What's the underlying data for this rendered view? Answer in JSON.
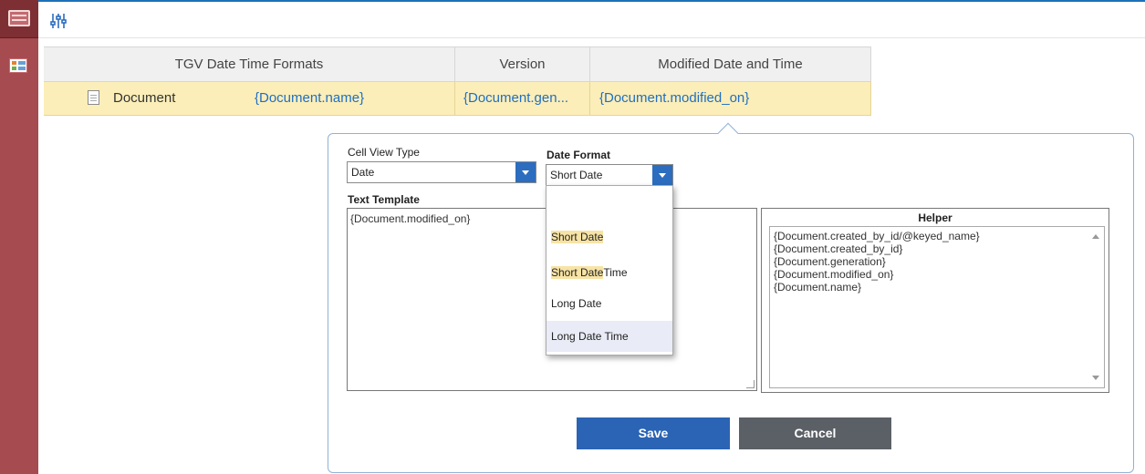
{
  "grid": {
    "columns": [
      "TGV Date Time Formats",
      "Version",
      "Modified Date and Time"
    ],
    "row": {
      "type": "Document",
      "name": "{Document.name}",
      "version": "{Document.gen...",
      "modified": "{Document.modified_on}"
    }
  },
  "popup": {
    "cell_view_type_label": "Cell View Type",
    "cell_view_type_value": "Date",
    "date_format_label": "Date Format",
    "date_format_value": "Short Date",
    "text_template_label": "Text Template",
    "text_template_value": "{Document.modified_on}",
    "dropdown_options": [
      {
        "highlight": "",
        "rest": ""
      },
      {
        "highlight": "Short Date",
        "rest": ""
      },
      {
        "highlight": "Short Date",
        "rest": "Time"
      },
      {
        "highlight": "",
        "rest": "Long Date"
      },
      {
        "highlight": "",
        "rest": "Long Date Time"
      }
    ],
    "helper_title": "Helper",
    "helper_items": [
      "{Document.created_by_id/@keyed_name}",
      "{Document.created_by_id}",
      "{Document.generation}",
      "{Document.modified_on}",
      "{Document.name}"
    ],
    "save_label": "Save",
    "cancel_label": "Cancel"
  },
  "colors": {
    "accent": "#2b64b4",
    "gutter": "#a64b4f",
    "row_highlight": "#fbeeb8",
    "link": "#1f6fc5"
  }
}
